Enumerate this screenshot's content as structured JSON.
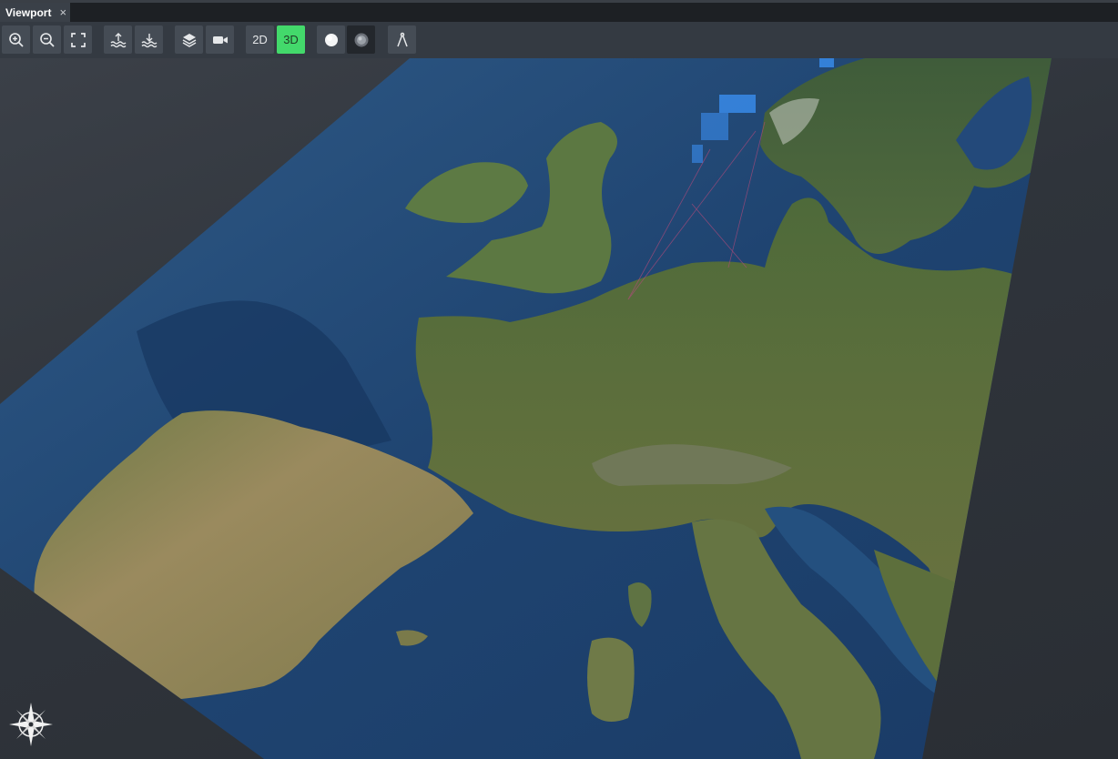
{
  "tab": {
    "title": "Viewport",
    "close_glyph": "×"
  },
  "toolbar": {
    "zoom_in": "zoom-in-icon",
    "zoom_out": "zoom-out-icon",
    "fit": "fit-extent-icon",
    "raise_surface": "raise-water-icon",
    "lower_surface": "lower-water-icon",
    "layers": "layers-icon",
    "camera": "video-camera-icon",
    "mode_2d_label": "2D",
    "mode_3d_label": "3D",
    "active_mode": "3D",
    "sphere_light": "white-sphere-icon",
    "sphere_dark": "globe-shaded-icon",
    "measure": "compass-divider-icon",
    "accent_color": "#43d96b"
  },
  "viewport": {
    "content": "3D satellite terrain view of Western Europe",
    "compass": "compass-rose-icon"
  }
}
